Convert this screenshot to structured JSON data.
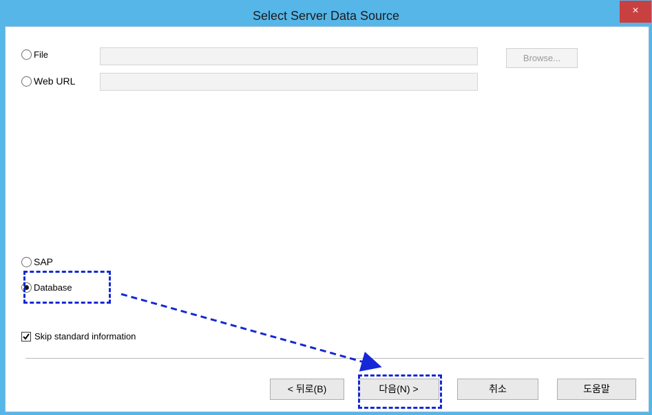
{
  "window": {
    "title": "Select Server Data Source",
    "close_label": "×"
  },
  "source_options": {
    "file_label": "File",
    "web_url_label": "Web URL",
    "sap_label": "SAP",
    "database_label": "Database",
    "selected": "Database"
  },
  "inputs": {
    "file_value": "",
    "web_url_value": ""
  },
  "browse_label": "Browse...",
  "skip_standard_info": {
    "label": "Skip standard information",
    "checked": true
  },
  "footer_buttons": {
    "back_label": "< 뒤로(B)",
    "next_label": "다음(N) >",
    "cancel_label": "취소",
    "help_label": "도움말"
  },
  "annotation_color": "#1527d6"
}
